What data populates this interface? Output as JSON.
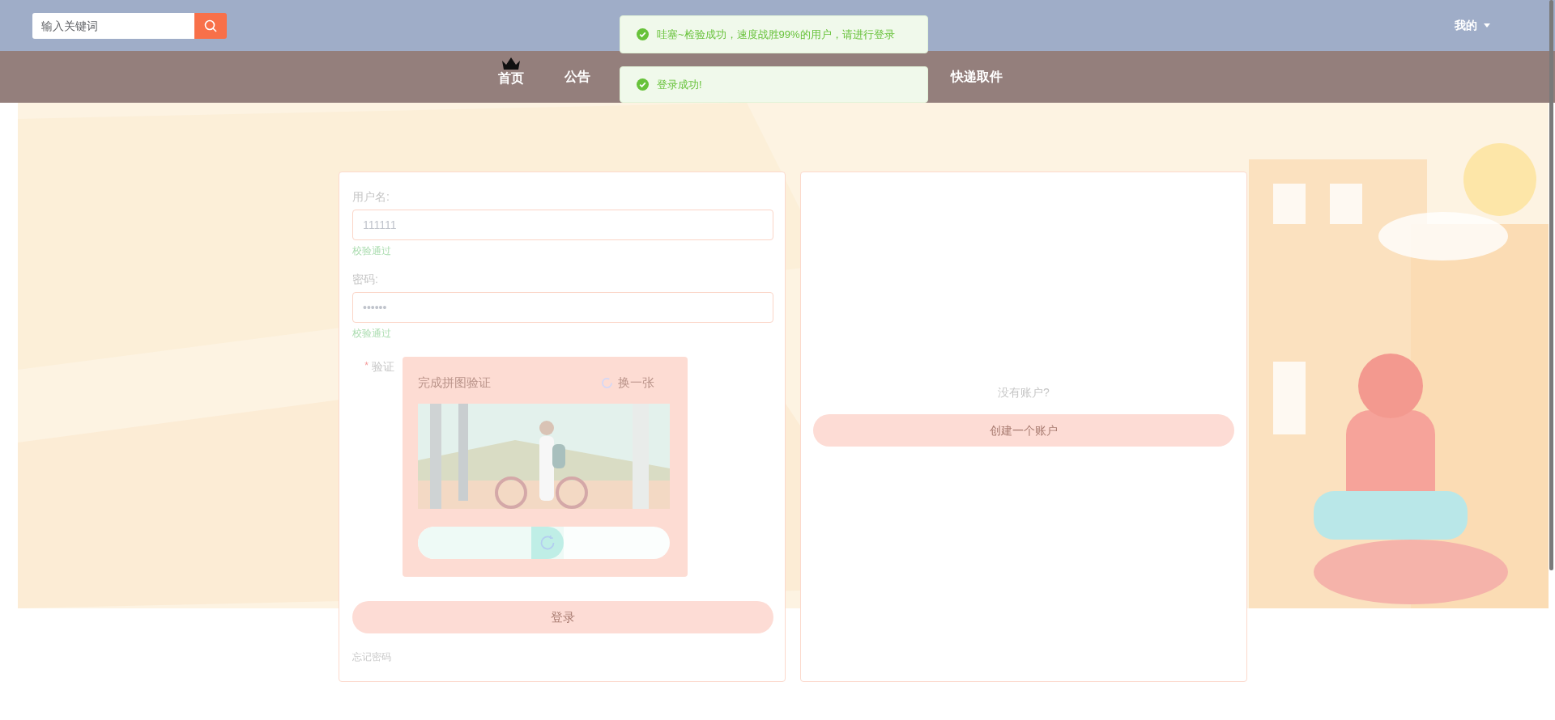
{
  "search": {
    "placeholder": "输入关键词"
  },
  "user_menu": {
    "label": "我的"
  },
  "nav": [
    {
      "label": "首页",
      "selected": true
    },
    {
      "label": "公告",
      "selected": false
    },
    {
      "label": "快递取件",
      "selected": false
    }
  ],
  "toasts": [
    {
      "kind": "success",
      "text": "哇塞~检验成功，速度战胜99%的用户，请进行登录"
    },
    {
      "kind": "success",
      "text": "登录成功!"
    }
  ],
  "login": {
    "fields": [
      {
        "label": "用户名:",
        "value": "111111",
        "status": "校验通过"
      },
      {
        "label": "密码:",
        "value": "••••••",
        "status": "校验通过"
      }
    ],
    "captcha": {
      "label": "验证",
      "required_mark": "*",
      "title": "完成拼图验证",
      "refresh": "换一张",
      "slider": {
        "level": 0.58
      }
    },
    "submit": "登录",
    "forgot": "忘记密码"
  },
  "register": {
    "prompt": "没有账户?",
    "button": "创建一个账户"
  }
}
